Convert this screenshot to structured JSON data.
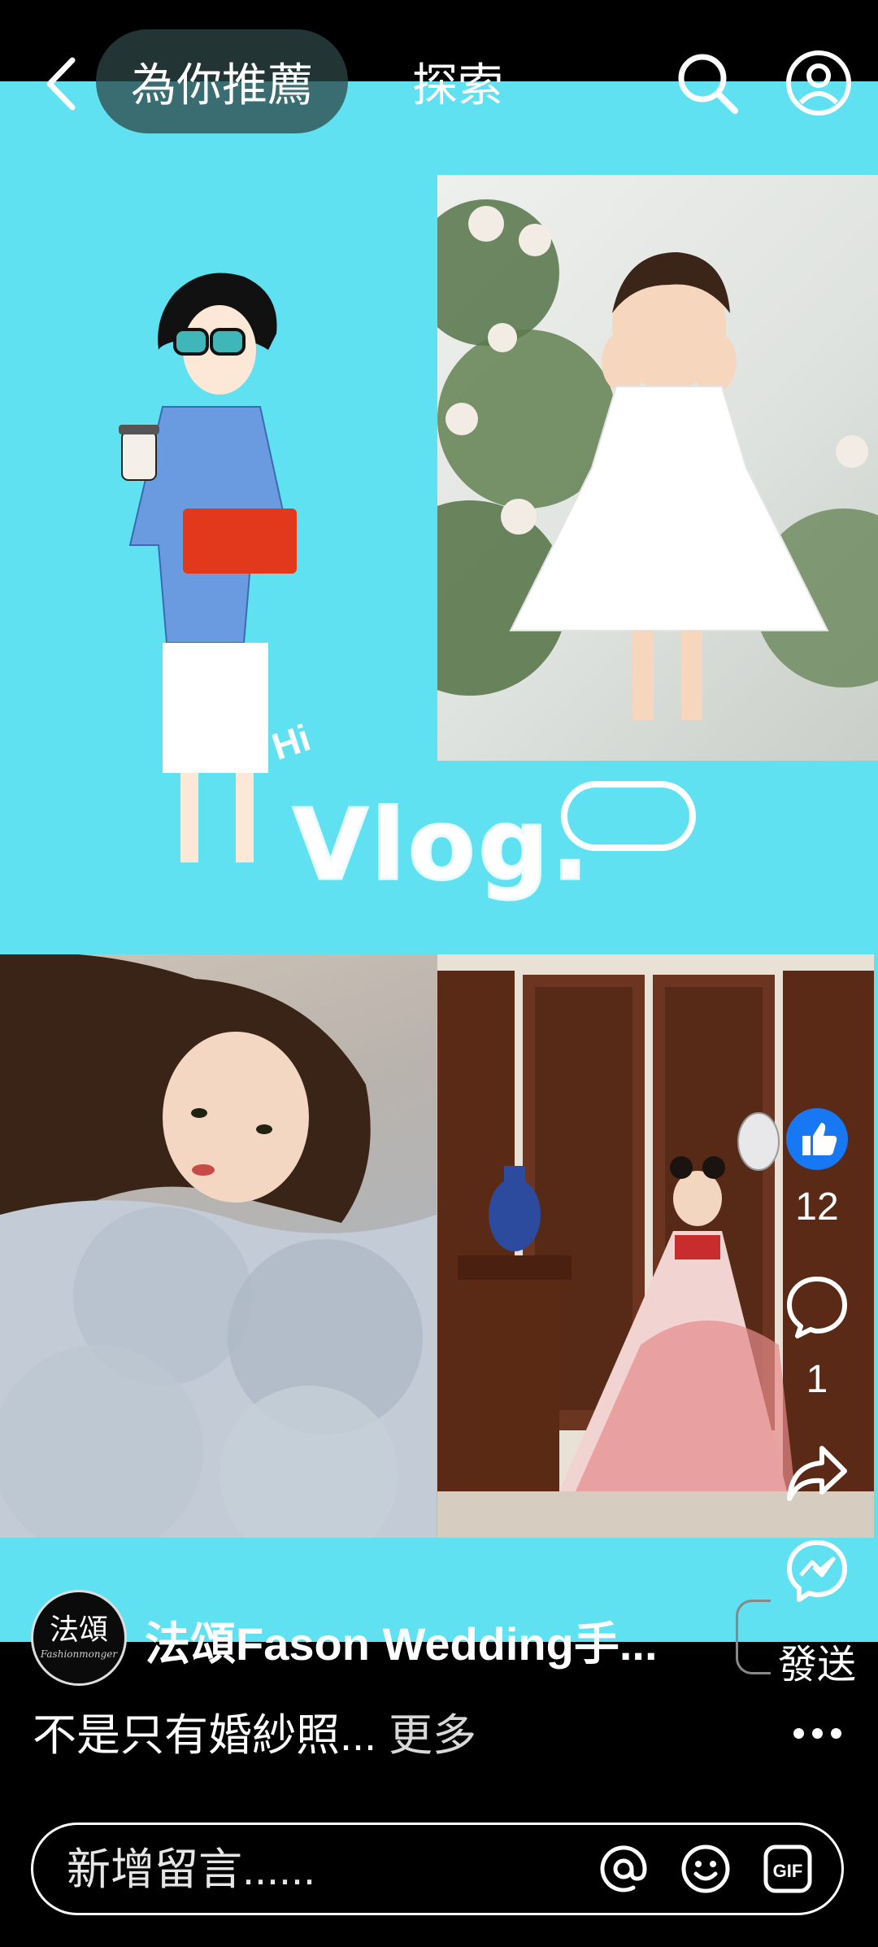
{
  "header": {
    "tabs": [
      {
        "label": "為你推薦",
        "active": true
      },
      {
        "label": "探索",
        "active": false
      }
    ],
    "icons": [
      "back-icon",
      "search-icon",
      "profile-icon"
    ]
  },
  "video": {
    "background_color": "#5fe1f2",
    "overlay_text": "Vlog.",
    "sticker_text": "Hi"
  },
  "actions": {
    "like_count": "12",
    "comment_count": "1",
    "send_label": "發送",
    "like_color": "#1877f2"
  },
  "post": {
    "avatar_text": "法頌",
    "avatar_subtext": "Fashionmonger",
    "author": "法頌Fason Wedding手...",
    "caption": "不是只有婚紗照...",
    "more_label": "更多"
  },
  "comment": {
    "placeholder": "新增留言......",
    "gif_label": "GIF"
  }
}
